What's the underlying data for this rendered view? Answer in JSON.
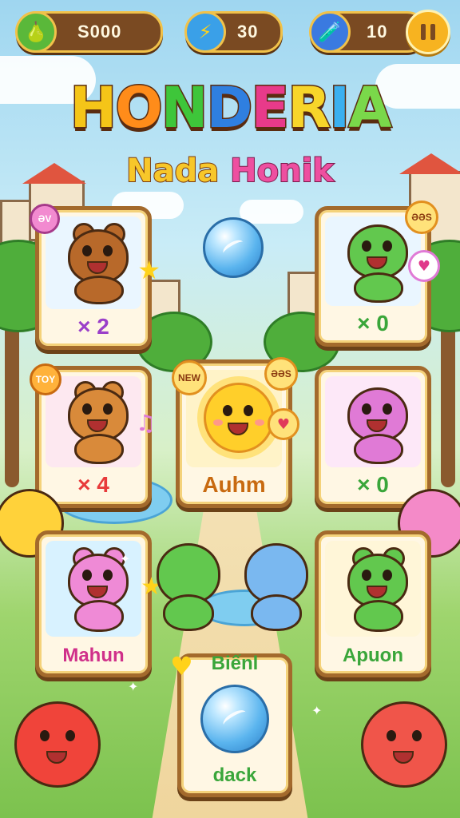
{
  "hud": {
    "coins": "S000",
    "gems": "30",
    "potions": "10"
  },
  "title": {
    "letters": [
      "H",
      "O",
      "N",
      "D",
      "E",
      "R",
      "I",
      "A"
    ],
    "colors": [
      "#f5c518",
      "#ff8c1a",
      "#3ec63a",
      "#2f7fe0",
      "#e83a8a",
      "#f7d52a",
      "#3ab0f0",
      "#7ad84a"
    ],
    "subtitle_a": "Nada",
    "subtitle_b": "Honik"
  },
  "cards": [
    {
      "id": "bear-card",
      "label": "× 2",
      "label_color": "#9b3fc9",
      "badge": "ƏV",
      "bg": "#eaf6ff",
      "creature": "brown-bear",
      "color": "#b8692a"
    },
    {
      "id": "dino-card",
      "label": "× 0",
      "label_color": "#3aa63a",
      "badge": "ƏƏS",
      "bg": "#eaf6ff",
      "creature": "green-dino",
      "color": "#62c84e"
    },
    {
      "id": "weasel-card",
      "label": "× 4",
      "label_color": "#e83a3a",
      "badge": "TOY",
      "bg": "#fde8f0",
      "creature": "orange-weasel",
      "color": "#d98a3a"
    },
    {
      "id": "sun-card",
      "label": "Auhm",
      "label_color": "#c86a10",
      "badge": "NEW",
      "badge2": "ƏƏS",
      "bg": "#fff3c8",
      "creature": "sun",
      "color": "#ffcf2a"
    },
    {
      "id": "pink-dino-card",
      "label": "× 0",
      "label_color": "#3aa63a",
      "bg": "#fde8f8",
      "creature": "pink-dino",
      "color": "#e07ad6"
    },
    {
      "id": "pink-bear-card",
      "label": "Mahun",
      "label_color": "#d0308a",
      "bg": "#d8f2ff",
      "creature": "pink-bear",
      "color": "#ef8ad6"
    },
    {
      "id": "green-bear-card",
      "label": "Apuon",
      "label_color": "#3aa63a",
      "bg": "#fff6d8",
      "creature": "green-bear",
      "color": "#62c84e"
    },
    {
      "id": "orb-card",
      "label": "dack",
      "label_color": "#3aa63a",
      "header": "Biếnl",
      "bg": "#fff6d8",
      "creature": "orb",
      "color": "#5ab4ee"
    }
  ]
}
